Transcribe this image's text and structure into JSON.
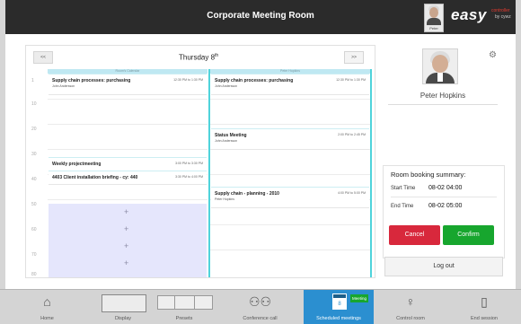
{
  "header": {
    "title": "Corporate Meeting Room",
    "avatar_name": "Peter",
    "logo_main": "easy",
    "logo_sub1": "controller",
    "logo_sub2": "by cywz"
  },
  "calendar": {
    "prev_label": "<<",
    "next_label": ">>",
    "date_day": "Thursday 8",
    "date_suffix": "th",
    "time_labels": [
      "1",
      "10",
      "20",
      "30",
      "40",
      "50",
      "60",
      "70",
      "80"
    ],
    "columns": [
      {
        "header": "Room's Calendar",
        "events": [
          {
            "title": "Supply chain processes: purchasing",
            "time": "12:30 PM to 1:30 PM",
            "organizer": "John Andersson"
          },
          {
            "title": "Weekly projectmeeting",
            "time": "3:00 PM to 3:30 PM",
            "organizer": ""
          },
          {
            "title": "4403 Client installation briefing - cy: 440",
            "time": "3:30 PM to 4:00 PM",
            "organizer": ""
          }
        ],
        "free_slots": [
          "+",
          "+",
          "+",
          "+"
        ]
      },
      {
        "header": "Peter Hopkins",
        "events": [
          {
            "title": "Supply chain processes: purchasing",
            "time": "12:30 PM to 1:30 PM",
            "organizer": "John Andersson"
          },
          {
            "title": "Status Meeting",
            "time": "2:00 PM to 2:45 PM",
            "organizer": "John Andersson"
          },
          {
            "title": "Supply chain - planning - 2010",
            "time": "4:00 PM to 5:00 PM",
            "organizer": "Peter Hopkins"
          }
        ]
      }
    ]
  },
  "profile": {
    "name": "Peter Hopkins",
    "gear_icon": "gear-icon"
  },
  "summary": {
    "title": "Room booking summary:",
    "start_label": "Start Time",
    "start_value": "08-02 04:00",
    "end_label": "End Time",
    "end_value": "08-02 05:00",
    "cancel_label": "Cancel",
    "confirm_label": "Confirm"
  },
  "logout_label": "Log out",
  "bottom_tabs": [
    {
      "label": "Home",
      "icon": "home-icon"
    },
    {
      "label": "Display",
      "icon": "display-icon"
    },
    {
      "label": "Presets",
      "icon": "presets-icon"
    },
    {
      "label": "Conference call",
      "icon": "conference-icon"
    },
    {
      "label": "Scheduled meetings",
      "icon": "calendar-icon",
      "badge": "Meeting",
      "day": "8"
    },
    {
      "label": "Control room",
      "icon": "bulb-icon"
    },
    {
      "label": "End session",
      "icon": "door-icon"
    }
  ],
  "colors": {
    "topbar": "#2b2b2b",
    "accent": "#2b8fd0",
    "cancel": "#d8283c",
    "confirm": "#17a62e",
    "free_block": "#e5e6fc",
    "column_line": "#4fd3db"
  }
}
